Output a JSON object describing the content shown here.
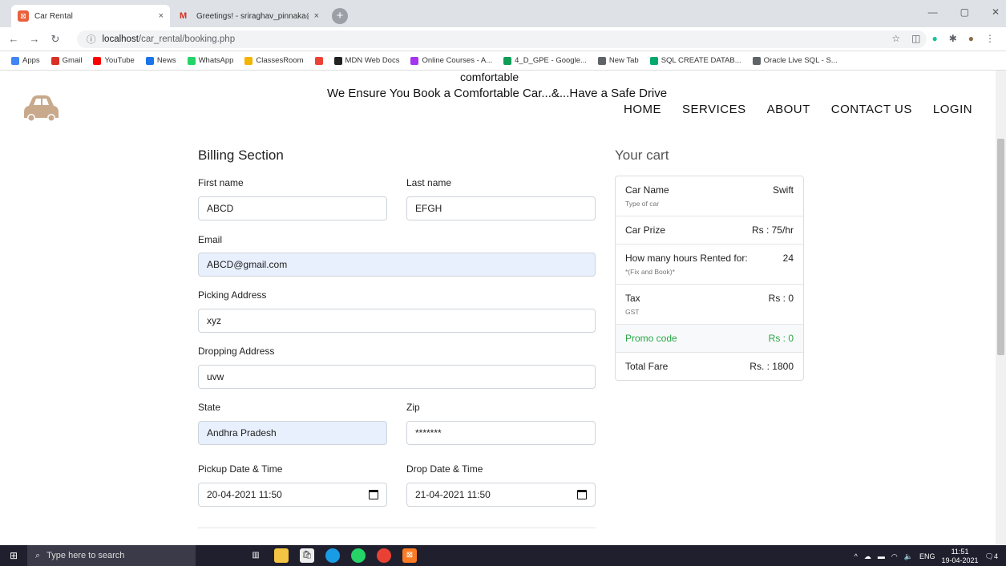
{
  "browser": {
    "tabs": [
      {
        "title": "Car Rental",
        "close": "×"
      },
      {
        "title": "Greetings! - sriraghav_pinnaka@",
        "close": "×"
      }
    ],
    "new_tab": "+",
    "url_host": "localhost",
    "url_path": "/car_rental/booking.php",
    "bookmarks": [
      {
        "label": "Apps",
        "color": "#4285f4"
      },
      {
        "label": "Gmail",
        "color": "#d93025"
      },
      {
        "label": "YouTube",
        "color": "#ff0000"
      },
      {
        "label": "News",
        "color": "#1a73e8"
      },
      {
        "label": "WhatsApp",
        "color": "#25d366"
      },
      {
        "label": "ClassesRoom",
        "color": "#f4b400"
      },
      {
        "label": "",
        "color": "#ea4335"
      },
      {
        "label": "MDN Web Docs",
        "color": "#222222"
      },
      {
        "label": "Online Courses - A...",
        "color": "#a435f0"
      },
      {
        "label": "4_D_GPE - Google...",
        "color": "#0f9d58"
      },
      {
        "label": "New Tab",
        "color": "#5f6368"
      },
      {
        "label": "SQL CREATE DATAB...",
        "color": "#04aa6d"
      },
      {
        "label": "Oracle Live SQL - S...",
        "color": "#5f6368"
      }
    ]
  },
  "site": {
    "tagline_top": "comfortable",
    "tagline": "We Ensure You Book a Comfortable Car...&...Have a Safe Drive",
    "logo_color": "#c8a98c",
    "nav": [
      "HOME",
      "SERVICES",
      "ABOUT",
      "CONTACT US",
      "LOGIN"
    ]
  },
  "billing": {
    "title": "Billing Section",
    "first_name_label": "First name",
    "first_name": "ABCD",
    "last_name_label": "Last name",
    "last_name": "EFGH",
    "email_label": "Email",
    "email": "ABCD@gmail.com",
    "picking_label": "Picking Address",
    "picking": "xyz",
    "dropping_label": "Dropping Address",
    "dropping": "uvw",
    "state_label": "State",
    "state": "Andhra Pradesh",
    "zip_label": "Zip",
    "zip": "*******",
    "pickup_label": "Pickup Date & Time",
    "pickup": "20-04-2021 11:50",
    "drop_label": "Drop Date & Time",
    "drop": "21-04-2021 11:50"
  },
  "cart": {
    "title": "Your cart",
    "rows": [
      {
        "label": "Car Name",
        "sub": "Type of car",
        "value": "Swift"
      },
      {
        "label": "Car Prize",
        "sub": "",
        "value": "Rs : 75/hr"
      },
      {
        "label": "How many hours Rented for:",
        "sub": "*(Fix and Book)*",
        "value": "24"
      },
      {
        "label": "Tax",
        "sub": "GST",
        "value": "Rs : 0"
      },
      {
        "label": "Promo code",
        "sub": "",
        "value": "Rs : 0"
      },
      {
        "label": "Total Fare",
        "sub": "",
        "value": "Rs. : 1800"
      }
    ]
  },
  "taskbar": {
    "search_placeholder": "Type here to search",
    "lang": "ENG",
    "time": "11:51",
    "date": "19-04-2021",
    "notif": "4"
  }
}
